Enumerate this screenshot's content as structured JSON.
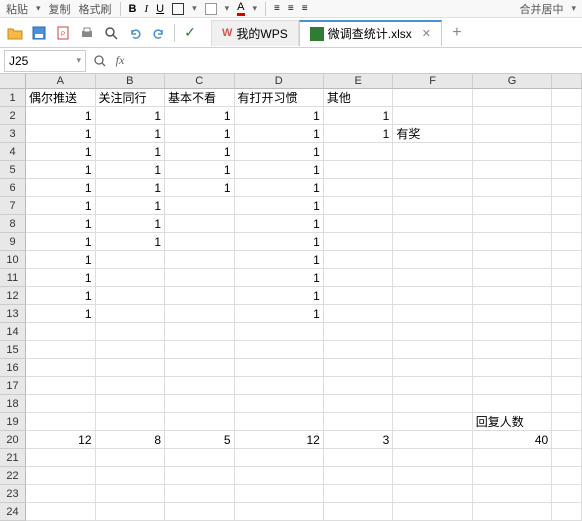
{
  "topbar": {
    "paste_label": "粘贴",
    "copy_label": "复制",
    "format_painter_label": "格式刷",
    "right_text": "合并居中"
  },
  "tabs": {
    "my_wps": "我的WPS",
    "active_tab": "微调查统计.xlsx",
    "add_symbol": "+"
  },
  "formula": {
    "name_box": "J25",
    "fx_label": "fx",
    "input_value": ""
  },
  "columns": [
    "A",
    "B",
    "C",
    "D",
    "E",
    "F",
    "G"
  ],
  "row_count": 24,
  "cells": {
    "A1": "偶尔推送",
    "B1": "关注同行",
    "C1": "基本不看",
    "D1": "有打开习惯",
    "E1": "其他",
    "A2": "1",
    "B2": "1",
    "C2": "1",
    "D2": "1",
    "E2": "1",
    "A3": "1",
    "B3": "1",
    "C3": "1",
    "D3": "1",
    "E3": "1",
    "F3": "有奖",
    "A4": "1",
    "B4": "1",
    "C4": "1",
    "D4": "1",
    "A5": "1",
    "B5": "1",
    "C5": "1",
    "D5": "1",
    "A6": "1",
    "B6": "1",
    "C6": "1",
    "D6": "1",
    "A7": "1",
    "B7": "1",
    "D7": "1",
    "A8": "1",
    "B8": "1",
    "D8": "1",
    "A9": "1",
    "B9": "1",
    "D9": "1",
    "A10": "1",
    "D10": "1",
    "A11": "1",
    "D11": "1",
    "A12": "1",
    "D12": "1",
    "A13": "1",
    "D13": "1",
    "G19": "回复人数",
    "A20": "12",
    "B20": "8",
    "C20": "5",
    "D20": "12",
    "E20": "3",
    "G20": "40"
  },
  "numeric_cols": [
    "A",
    "B",
    "C",
    "D",
    "E",
    "G"
  ],
  "text_rows": [
    1
  ]
}
